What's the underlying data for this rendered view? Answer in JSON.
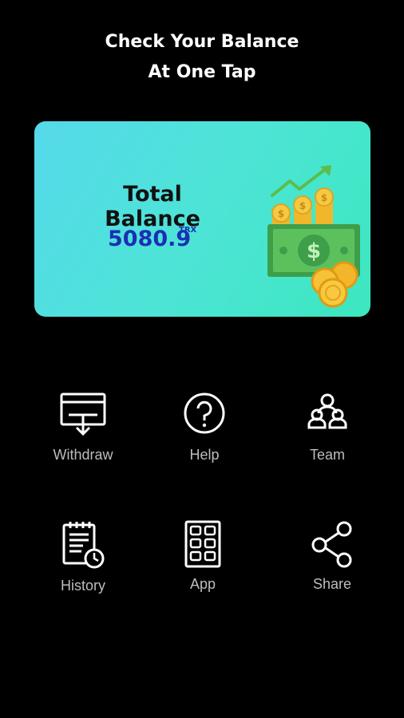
{
  "headline": {
    "line1": "Check Your Balance",
    "line2": "At One Tap"
  },
  "balance": {
    "label": "Total Balance",
    "value": "5080.9",
    "unit": "TRX"
  },
  "colors": {
    "card_start": "#55d9ea",
    "card_end": "#3ce7bf",
    "value": "#1b2fb3",
    "label": "#bdbdbd"
  },
  "menu": [
    {
      "label": "Withdraw",
      "icon": "withdraw-icon"
    },
    {
      "label": "Help",
      "icon": "help-icon"
    },
    {
      "label": "Team",
      "icon": "team-icon"
    },
    {
      "label": "History",
      "icon": "history-icon"
    },
    {
      "label": "App",
      "icon": "app-grid-icon"
    },
    {
      "label": "Share",
      "icon": "share-icon"
    }
  ]
}
